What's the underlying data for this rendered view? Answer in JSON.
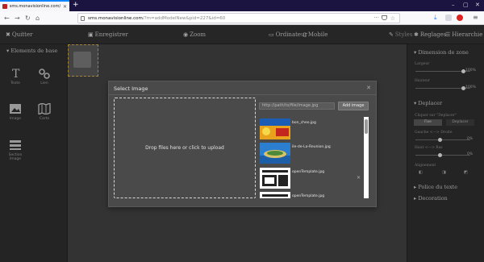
{
  "browser": {
    "tab_title": "sms.monavisionline.com/?m=addi",
    "url_host": "sms.monavisionline.com",
    "url_prefix": "",
    "url_path": "/?m=addModelNew&pid=227&id=60"
  },
  "toolbar": {
    "quit_label": "Quitter",
    "save_label": "Enregistrer",
    "zoom_label": "Zoom",
    "desktop_label": "Ordinateur",
    "mobile_label": "Mobile",
    "styles_label": "Styles",
    "settings_label": "Reglages",
    "hierarchy_label": "Hierarchie"
  },
  "left_panel": {
    "section_title": "Elements de base",
    "elements": [
      {
        "label": "Texte",
        "icon": "text-icon"
      },
      {
        "label": "Lien",
        "icon": "link-icon"
      },
      {
        "label": "Image",
        "icon": "image-icon"
      },
      {
        "label": "Carte",
        "icon": "map-icon"
      },
      {
        "label": "Section Image",
        "icon": "section-image-icon"
      }
    ]
  },
  "right_panel": {
    "dimension_title": "Dimension de zone",
    "width_label": "Largeur",
    "width_value": "100%",
    "height_label": "Hauteur",
    "height_value": "100%",
    "move_title": "Deplacer",
    "drag_label": "Cliquer sur \"Deplacer\"",
    "toggle_fixed": "Fixe",
    "toggle_move": "Deplacer",
    "left_right_label": "Gauche <---> Droite",
    "left_right_value": "0%",
    "top_bottom_label": "Haut <---> Bas",
    "top_bottom_value": "0%",
    "align_label": "Alignement",
    "font_title": "Police du texte",
    "decoration_title": "Decoration"
  },
  "modal": {
    "title": "Select Image",
    "dropzone_text": "Drop files here or click to upload",
    "path_placeholder": "http://path/to/file/image.jpg",
    "add_button": "Add image",
    "files": [
      {
        "name": "bon_cheo.jpg"
      },
      {
        "name": "ile-de-La-Reunion.jpg"
      },
      {
        "name": "openTemplate.jpg"
      },
      {
        "name": "openTemplate.jpg"
      }
    ]
  }
}
